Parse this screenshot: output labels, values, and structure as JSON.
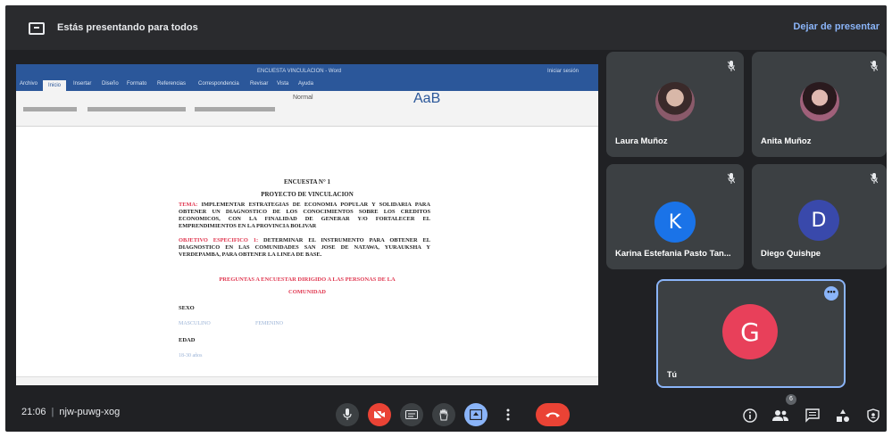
{
  "presenting_bar": {
    "text": "Estás presentando para todos",
    "stop_label": "Dejar de presentar"
  },
  "document": {
    "window_title": "ENCUESTA VINCULACION - Word",
    "right_title": "Iniciar sesión",
    "menu": [
      "Archivo",
      "Inicio",
      "Insertar",
      "Diseño",
      "Formato",
      "Referencias",
      "Correspondencia",
      "Revisar",
      "Vista",
      "Ayuda"
    ],
    "styles_label": "Normal",
    "aab": "AaB",
    "heading1": "ENCUESTA N° 1",
    "heading2": "PROYECTO DE VINCULACION",
    "tema_label": "TEMA:",
    "tema_text": "IMPLEMENTAR ESTRATEGIAS DE ECONOMIA POPULAR Y SOLIDARIA PARA OBTENER UN DIAGNOSTICO DE LOS CONOCIMIENTOS SOBRE LOS CREDITOS ECONOMICOS, CON LA FINALIDAD DE GENERAR Y/O FORTALECER EL EMPRENDIMIENTOS EN LA PROVINCIA BOLIVAR",
    "objetivo_label": "OBJETIVO ESPECIFICO 1:",
    "objetivo_text": "DETERMINAR EL INSTRUMENTO PARA OBTENER EL DIAGNOSTICO EN LAS COMUNIDADES SAN JOSE DE NATAWA, YURAUKSHA Y VERDEPAMBA, PARA OBTENER LA LINEA DE BASE.",
    "preguntas_line1": "PREGUNTAS A ENCUESTAR DIRIGIDO A LAS PERSONAS DE LA",
    "preguntas_line2": "COMUNIDAD",
    "sexo_label": "SEXO",
    "option_masculino": "MASCULINO",
    "option_femenino": "FEMENINO",
    "edad_label": "EDAD",
    "edad_option": "18-30 años"
  },
  "participants": [
    {
      "name": "Laura Muñoz",
      "type": "photo"
    },
    {
      "name": "Anita Muñoz",
      "type": "photo"
    },
    {
      "name": "Karina Estefania Pasto Tan...",
      "type": "letter",
      "letter": "K",
      "color": "#1a73e8"
    },
    {
      "name": "Diego Quishpe",
      "type": "letter",
      "letter": "D",
      "color": "#3949ab"
    }
  ],
  "self_tile": {
    "name": "Tú",
    "letter": "G",
    "color": "#e8405a",
    "menu_icon": "more-icon"
  },
  "bottom_bar": {
    "time": "21:06",
    "meeting_code": "njw-puwg-xog",
    "people_count": "6",
    "controls": [
      "mic-icon",
      "camera-off-icon",
      "captions-icon",
      "raise-hand-icon",
      "present-icon",
      "more-vert-icon",
      "hang-up-icon"
    ],
    "right_icons": [
      "info-icon",
      "people-icon",
      "chat-icon",
      "activities-icon",
      "host-controls-icon"
    ]
  },
  "colors": {
    "background": "#202124",
    "tile": "#3c4043",
    "accent": "#8ab4f8",
    "danger": "#ea4335",
    "word_blue": "#2b579a"
  }
}
